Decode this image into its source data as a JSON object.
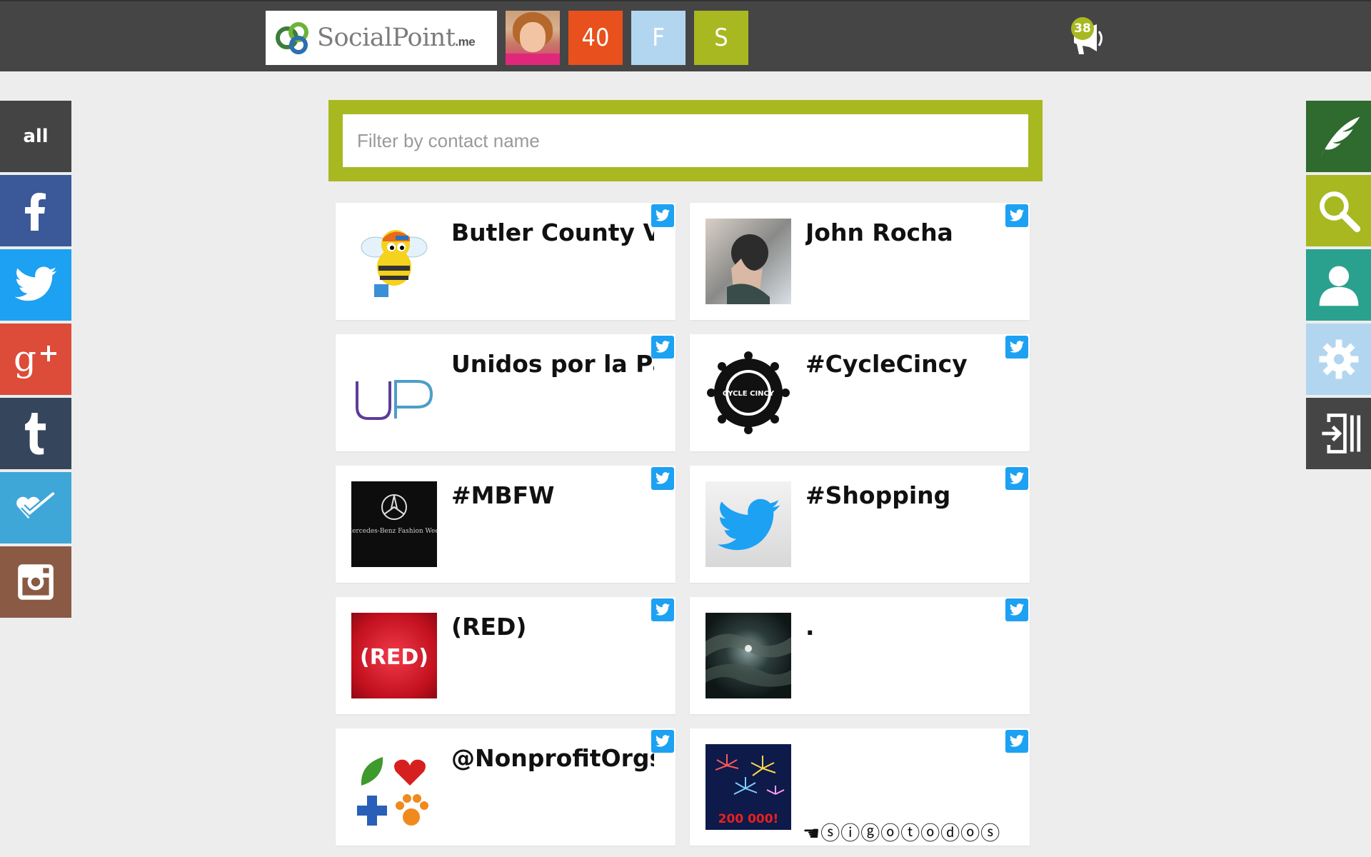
{
  "header": {
    "logo_text": "SocialPoint",
    "logo_suffix": ".me",
    "count_tile": "40",
    "tile_f": "F",
    "tile_s": "S",
    "notification_count": "38",
    "colors": {
      "bar": "#454545",
      "count_tile": "#e8511d",
      "tile_f": "#b3d6f0",
      "tile_s": "#a8b820"
    }
  },
  "left_sidebar": {
    "items": [
      {
        "label": "all",
        "icon": "all",
        "color": "#444444"
      },
      {
        "label": "",
        "icon": "facebook-icon",
        "color": "#3b5998"
      },
      {
        "label": "",
        "icon": "twitter-icon",
        "color": "#1da1f2"
      },
      {
        "label": "",
        "icon": "google-plus-icon",
        "color": "#dd4b39"
      },
      {
        "label": "",
        "icon": "tumblr-icon",
        "color": "#35465c"
      },
      {
        "label": "",
        "icon": "foursquare-icon",
        "color": "#3fa6d8"
      },
      {
        "label": "",
        "icon": "instagram-icon",
        "color": "#8a5a44"
      }
    ]
  },
  "right_sidebar": {
    "items": [
      {
        "icon": "quill-icon",
        "color": "#2f6a2f"
      },
      {
        "icon": "search-icon",
        "color": "#a8b820"
      },
      {
        "icon": "user-icon",
        "color": "#2aa18e"
      },
      {
        "icon": "gear-icon",
        "color": "#b3d6f0"
      },
      {
        "icon": "logout-icon",
        "color": "#454545"
      }
    ]
  },
  "filter": {
    "placeholder": "Filter by contact name",
    "value": "",
    "color": "#a8b820"
  },
  "contacts": [
    {
      "name": "Butler County VB",
      "network": "twitter-icon"
    },
    {
      "name": "John Rocha",
      "network": "twitter-icon"
    },
    {
      "name": "Unidos por la Paz",
      "network": "twitter-icon"
    },
    {
      "name": "#CycleCincy",
      "network": "twitter-icon",
      "thumb_text": "CYCLE CINCY"
    },
    {
      "name": "#MBFW",
      "network": "twitter-icon",
      "thumb_text": "Mercedes-Benz Fashion Week"
    },
    {
      "name": "#Shopping",
      "network": "twitter-icon"
    },
    {
      "name": "(RED)",
      "network": "twitter-icon",
      "thumb_text": "(RED)"
    },
    {
      "name": ".",
      "network": "twitter-icon"
    },
    {
      "name": "@NonprofitOrgs",
      "network": "twitter-icon"
    },
    {
      "name": "",
      "network": "twitter-icon",
      "thumb_text": "200 000!",
      "extra": "☚ⓢⓘⓖⓞⓣⓞⓓⓞⓢ"
    }
  ]
}
